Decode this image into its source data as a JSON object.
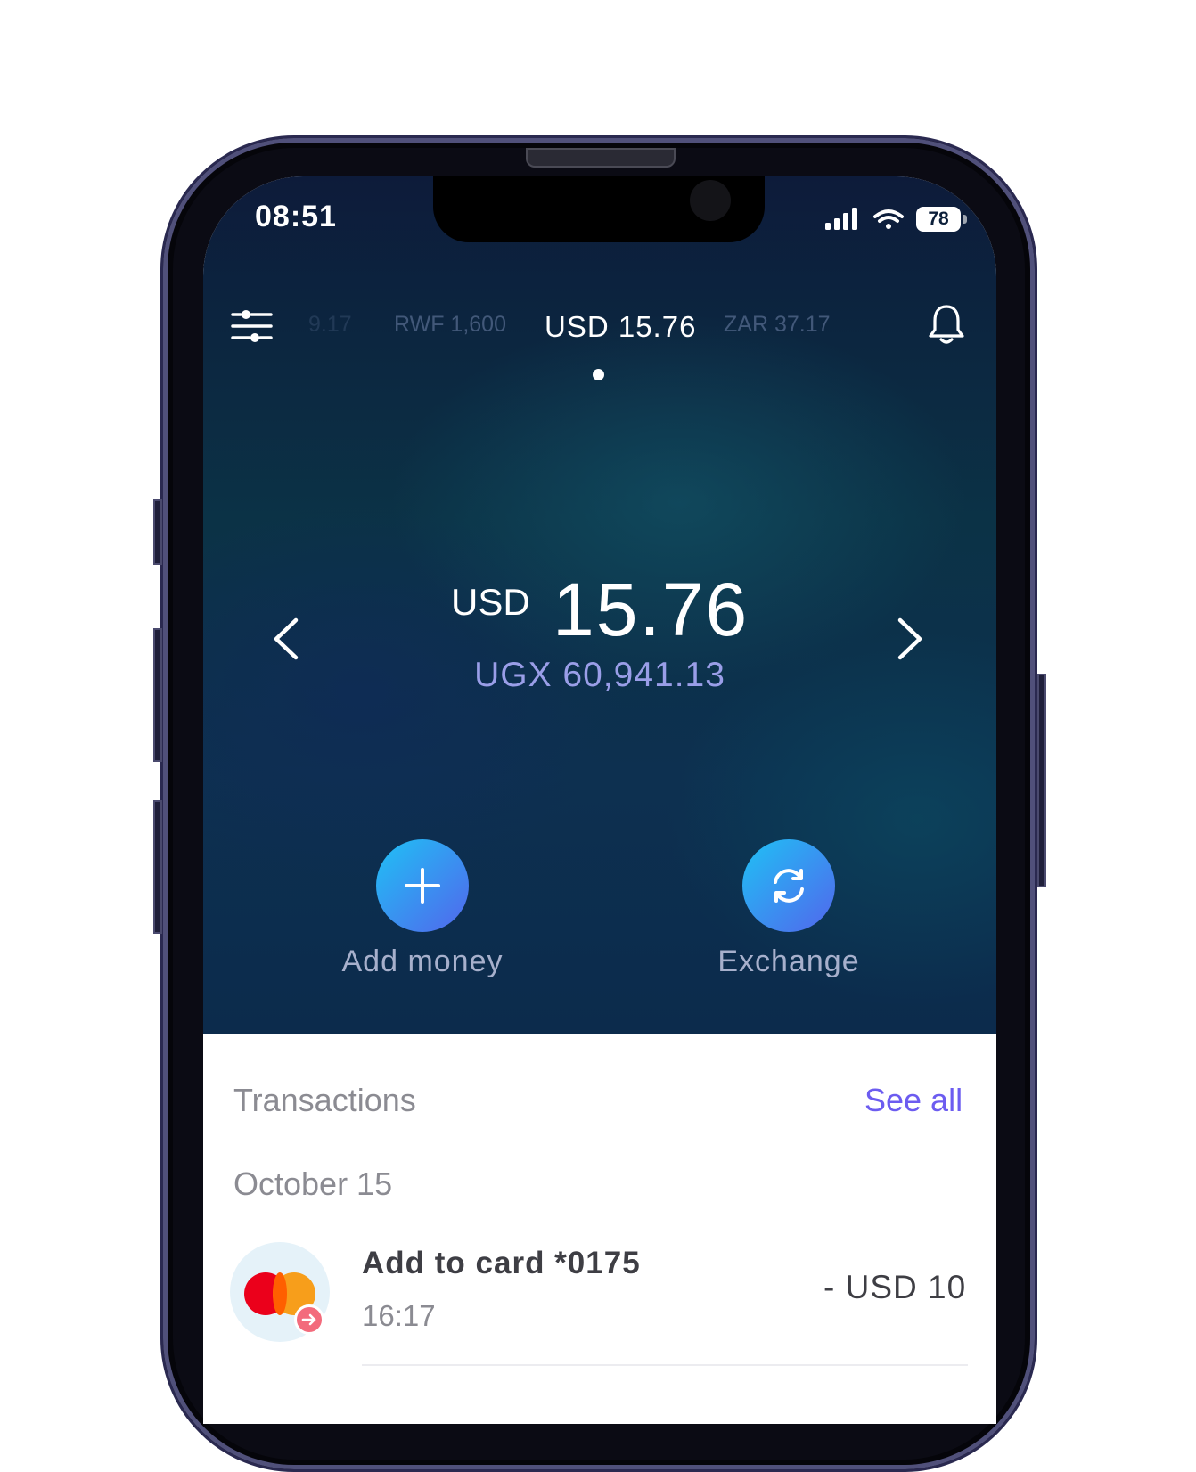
{
  "status_bar": {
    "time": "08:51",
    "battery": "78"
  },
  "currency_tabs": [
    {
      "label": "9.17"
    },
    {
      "label": "RWF 1,600"
    },
    {
      "label": "USD 15.76"
    },
    {
      "label": "ZAR 37.17"
    }
  ],
  "balance": {
    "currency": "USD",
    "amount": "15.76",
    "converted": "UGX 60,941.13"
  },
  "actions": {
    "add_money": "Add money",
    "exchange": "Exchange"
  },
  "transactions": {
    "title": "Transactions",
    "see_all": "See all",
    "groups": [
      {
        "date": "October 15",
        "items": [
          {
            "name": "Add to card *0175",
            "time": "16:17",
            "amount": "- USD 10",
            "icon": "mastercard-icon"
          }
        ]
      }
    ]
  },
  "colors": {
    "accent": "#6c5cf0",
    "button_gradient_start": "#1fc1f5",
    "button_gradient_end": "#5266ec",
    "hero_background": "#0b3246"
  }
}
